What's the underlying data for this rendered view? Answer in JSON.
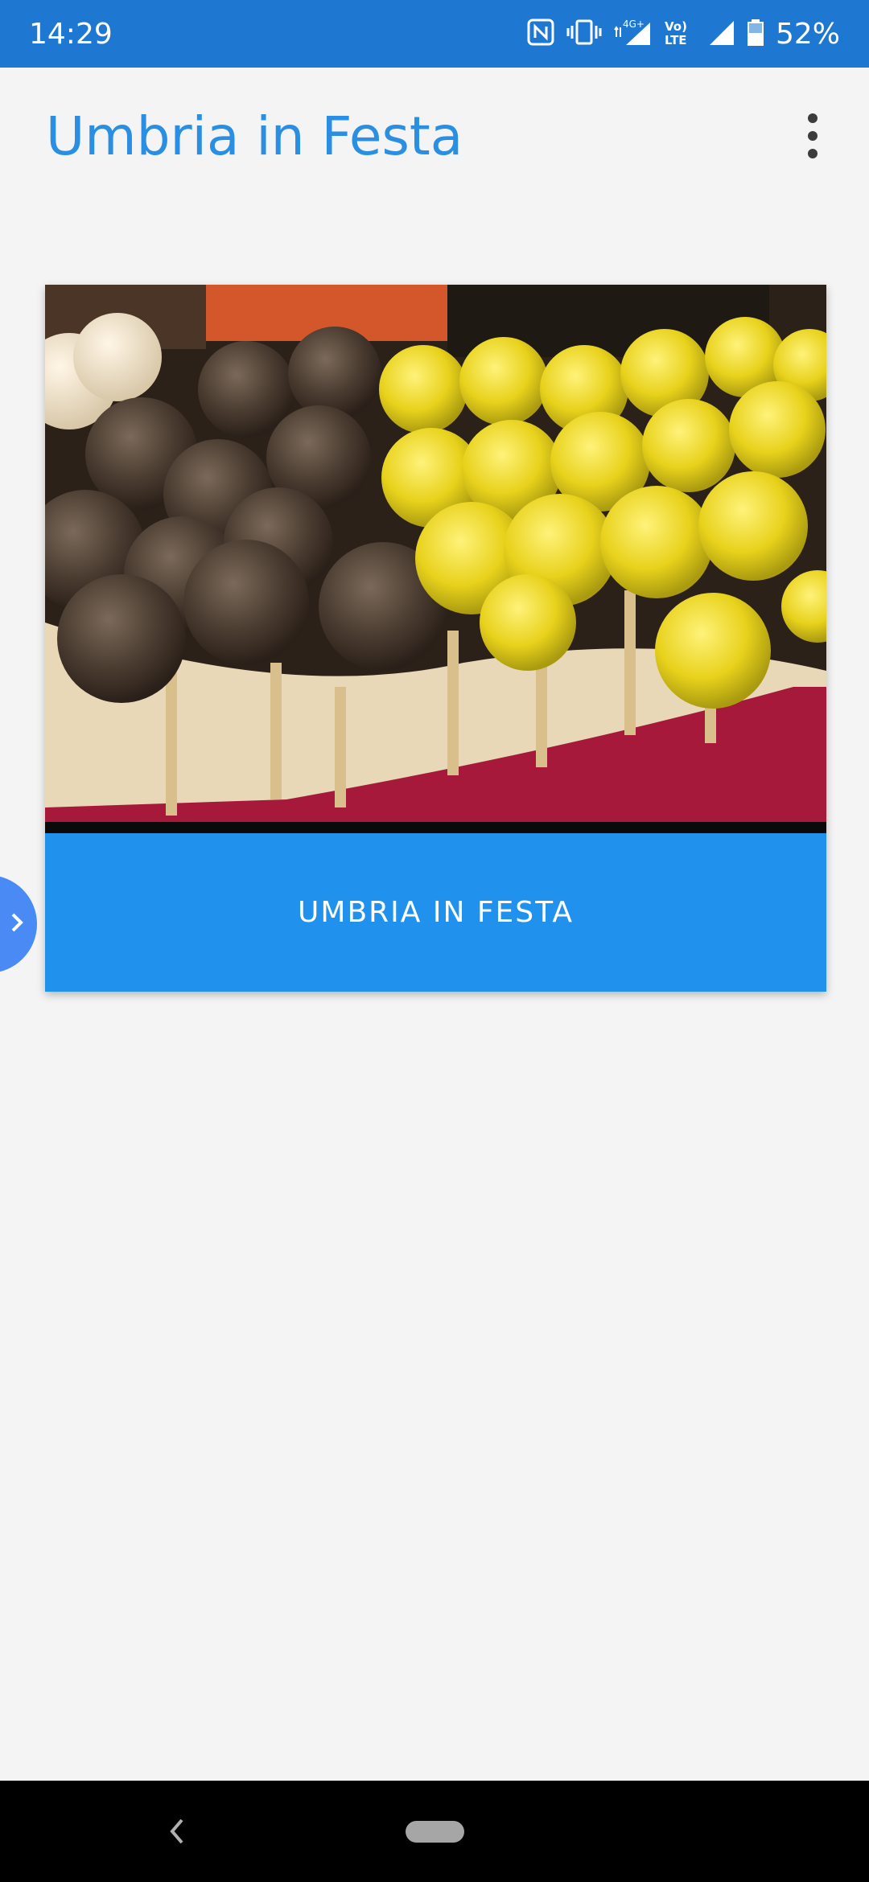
{
  "status_bar": {
    "time": "14:29",
    "network_label": "4G+",
    "volte_label": "Vo) LTE",
    "battery_percent": "52%",
    "icons": [
      "nfc-icon",
      "vibrate-icon",
      "signal-4g-icon",
      "volte-icon",
      "signal-icon",
      "battery-icon"
    ]
  },
  "app_bar": {
    "title": "Umbria in Festa",
    "menu_icon": "more-vert-icon"
  },
  "card": {
    "image_alt": "cake pops",
    "button_label": "UMBRIA IN FESTA"
  },
  "side_tab": {
    "icon": "chevron-right-icon"
  },
  "nav_bar": {
    "back_icon": "back-icon",
    "home_icon": "home-pill-icon"
  },
  "colors": {
    "status_bar": "#1e78d2",
    "title": "#2a8fe3",
    "card_button": "#2191ee",
    "side_tab": "#4a8af4",
    "background": "#f4f4f4"
  }
}
